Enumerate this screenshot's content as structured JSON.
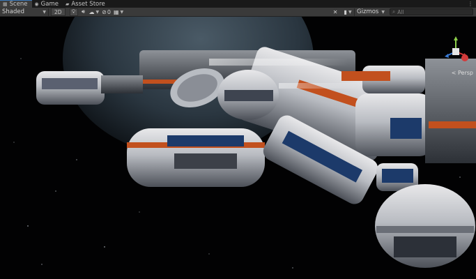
{
  "tabs": [
    {
      "label": "Scene",
      "icon": "scene-grid-icon",
      "active": true
    },
    {
      "label": "Game",
      "icon": "gamepad-icon",
      "active": false
    },
    {
      "label": "Asset Store",
      "icon": "shopping-bag-icon",
      "active": false
    }
  ],
  "toolbar": {
    "draw_mode": "Shaded",
    "toggle_2d": "2D",
    "hidden_count": "0",
    "gizmos_label": "Gizmos",
    "search_placeholder": "All"
  },
  "viewport": {
    "projection_label": "< Persp"
  },
  "colors": {
    "tab_active_accent": "#3a79bb",
    "toolbar_bg": "#3a3a3a",
    "space_bg": "#020203",
    "station_orange": "#c2501e"
  }
}
